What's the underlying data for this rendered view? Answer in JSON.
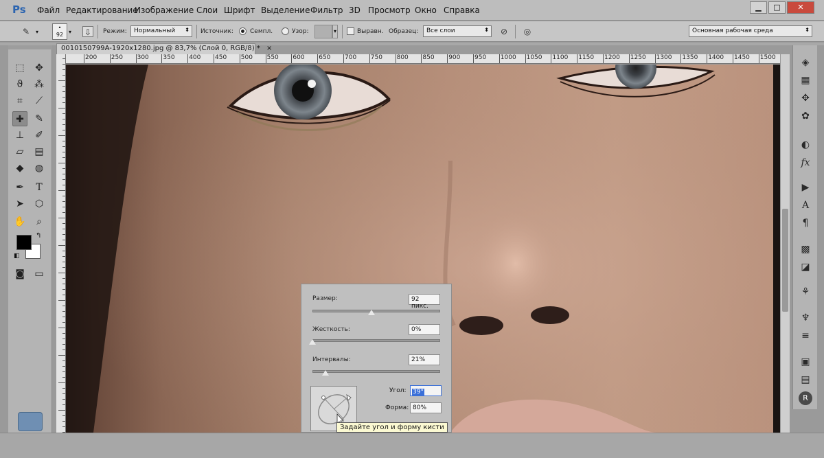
{
  "app": {
    "logo": "Ps"
  },
  "menu": [
    "Файл",
    "Редактирование",
    "Изображение",
    "Слои",
    "Шрифт",
    "Выделение",
    "Фильтр",
    "3D",
    "Просмотр",
    "Окно",
    "Справка"
  ],
  "window_buttons": {
    "minimize": "▁",
    "restore": "□",
    "close": "✕"
  },
  "options": {
    "brush_size": "92",
    "mode_label": "Режим:",
    "mode_value": "Нормальный",
    "source_label": "Источник:",
    "source_sampled": "Семпл.",
    "source_pattern": "Узор:",
    "aligned": "Выравн.",
    "sample_label": "Образец:",
    "sample_value": "Все слои",
    "workspace": "Основная рабочая среда"
  },
  "document": {
    "tab_title": "0010150799A-1920x1280.jpg @ 83,7% (Слой 0, RGB/8) *",
    "tab_close": "×",
    "ruler_h": [
      "200",
      "250",
      "300",
      "350",
      "400",
      "450",
      "500",
      "550",
      "600",
      "650",
      "700",
      "750",
      "800",
      "850",
      "900",
      "950",
      "1000",
      "1050",
      "1100",
      "1150",
      "1200",
      "1250",
      "1300",
      "1350",
      "1400",
      "1450",
      "1500"
    ]
  },
  "brush_popup": {
    "size_label": "Размер:",
    "size_value": "92 пикс.",
    "size_pct": 0.46,
    "hardness_label": "Жесткость:",
    "hardness_value": "0%",
    "hardness_pct": 0.0,
    "spacing_label": "Интервалы:",
    "spacing_value": "21%",
    "spacing_pct": 0.1,
    "angle_label": "Угол:",
    "angle_value": "39°",
    "roundness_label": "Форма:",
    "roundness_value": "80%"
  },
  "tooltip": "Задайте угол и форму кисти",
  "colors": {
    "foreground": "#000000",
    "background": "#ffffff",
    "ps_blue": "#2b64b0"
  },
  "tools_left": [
    "marquee-icon",
    "move-icon",
    "lasso-icon",
    "quick-select-icon",
    "crop-icon",
    "eyedropper-icon",
    "healing-brush-icon",
    "brush-icon",
    "clone-stamp-icon",
    "history-brush-icon",
    "eraser-icon",
    "gradient-icon",
    "blur-icon",
    "dodge-icon",
    "pen-icon",
    "type-icon",
    "path-select-icon",
    "shape-icon",
    "hand-icon",
    "zoom-icon"
  ],
  "tools_right": [
    "layers-icon",
    "channels-icon",
    "paths-icon",
    "adjustments-icon",
    "styles-icon",
    "fx-icon",
    "actions-icon",
    "character-icon",
    "paragraph-icon",
    "swatches-icon",
    "navigator-icon",
    "tool-presets-icon",
    "brush-presets-icon",
    "notes-icon",
    "info-icon",
    "r-icon"
  ]
}
